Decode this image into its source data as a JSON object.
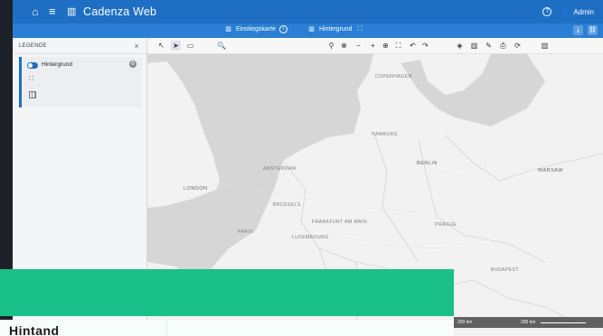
{
  "app": {
    "title": "Cadenza Web",
    "user": "Admin"
  },
  "subbar": {
    "tab1": "Einstiegskarte",
    "tab2": "Hintergrund"
  },
  "legend": {
    "header": "LEGENDE",
    "layer_label": "Hintergrund"
  },
  "map": {
    "labels": [
      "LONDON",
      "AMSTERDAM",
      "BRUSSELS",
      "FRANKFURT AM MAIN",
      "LUXEMBOURG",
      "PARIS",
      "BERLIN",
      "HAMBURG",
      "PRAGUE",
      "WARSAW",
      "BUDAPEST",
      "COPENHAGEN"
    ],
    "scale_left": "200 km",
    "scale_right": "200 km"
  },
  "overlay": {
    "card_text": "Hintand"
  },
  "colors": {
    "topbar": "#1e6fc4",
    "subbar": "#2a7fd4",
    "green_banner": "#19c088",
    "map_land": "#f2f2f2",
    "map_sea": "#d6d6d6"
  }
}
